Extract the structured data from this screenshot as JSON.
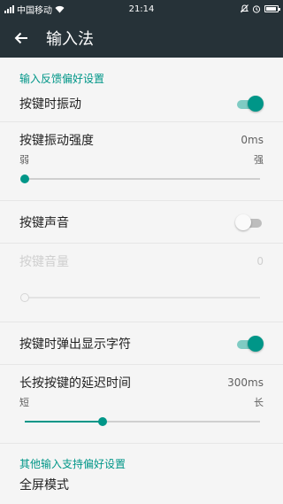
{
  "status_bar": {
    "carrier": "中国移动",
    "time": "21:14"
  },
  "app_bar": {
    "title": "输入法"
  },
  "sections": [
    {
      "header": "输入反馈偏好设置",
      "vibrate_on_key": {
        "label": "按键时振动",
        "enabled": true
      },
      "vibration_strength": {
        "label": "按键振动强度",
        "value": "0ms",
        "min_label": "弱",
        "max_label": "强",
        "level": 0.0
      },
      "key_sound": {
        "label": "按键声音",
        "enabled": false
      },
      "key_volume": {
        "label": "按键音量",
        "value": "0",
        "level": 0.0,
        "disabled": true
      },
      "popup_on_key": {
        "label": "按键时弹出显示字符",
        "enabled": true
      },
      "long_press_delay": {
        "label": "长按按键的延迟时间",
        "value": "300ms",
        "min_label": "短",
        "max_label": "长",
        "level": 0.33
      }
    },
    {
      "header": "其他输入支持偏好设置",
      "next_item_label": "全屏模式"
    }
  ],
  "colors": {
    "accent": "#009688",
    "app_bar": "#263238",
    "background": "#f5f5f5"
  },
  "icons": {
    "back": "arrow-left-icon",
    "wifi": "wifi-icon",
    "alarm": "alarm-icon",
    "mute": "mute-icon",
    "battery": "battery-icon"
  }
}
